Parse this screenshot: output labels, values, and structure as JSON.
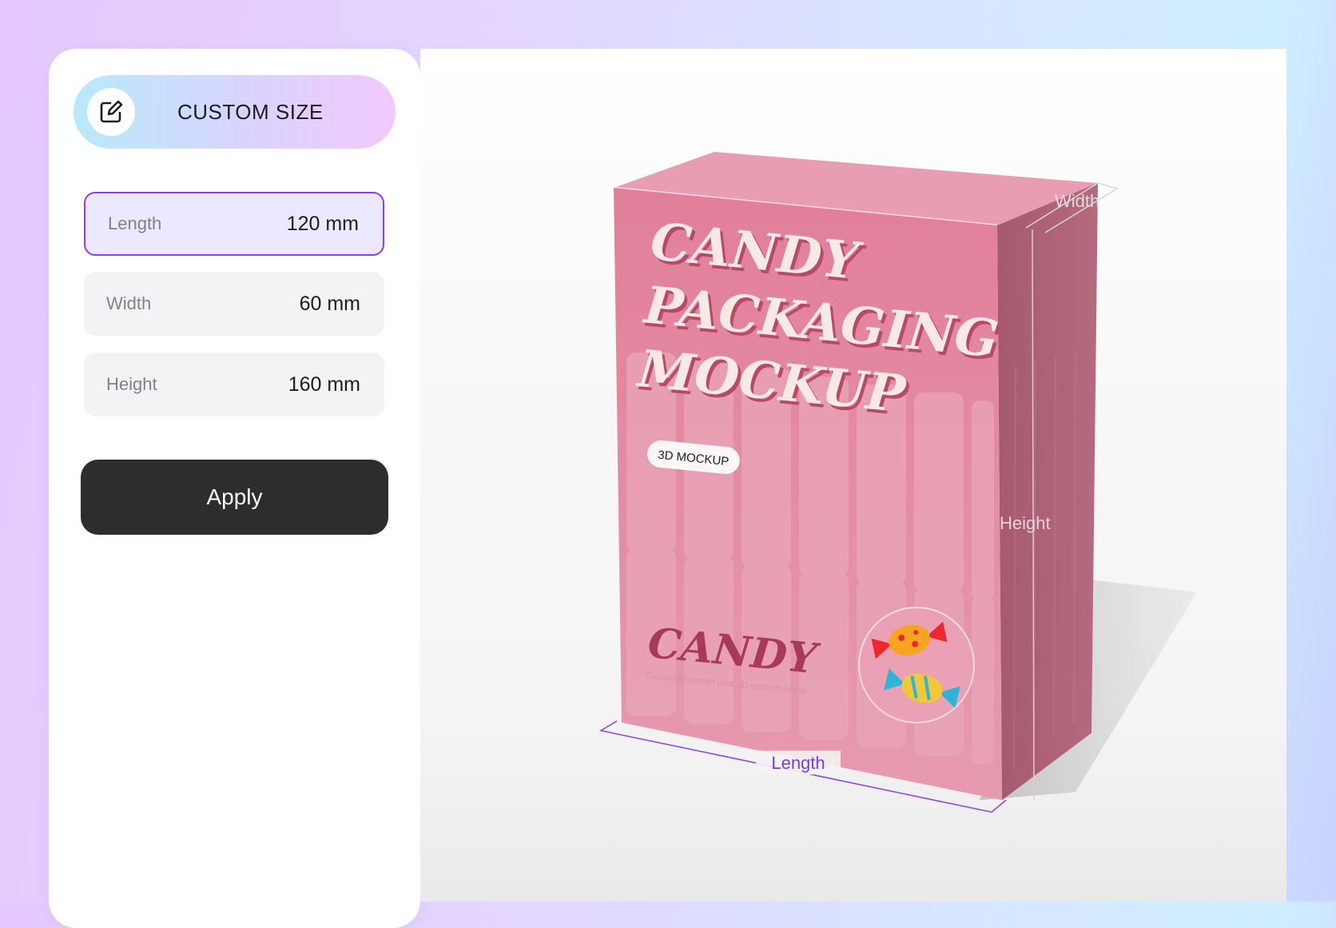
{
  "panel": {
    "header": {
      "title": "CUSTOM SIZE",
      "icon": "edit-icon"
    },
    "fields": [
      {
        "key": "length",
        "label": "Length",
        "value": "120 mm",
        "active": true
      },
      {
        "key": "width",
        "label": "Width",
        "value": "60 mm",
        "active": false
      },
      {
        "key": "height",
        "label": "Height",
        "value": "160 mm",
        "active": false
      }
    ],
    "apply_label": "Apply"
  },
  "preview": {
    "box_text": {
      "line1": "CANDY",
      "line2": "PACKAGING",
      "line3": "MOCKUP",
      "badge": "3D MOCKUP",
      "brand": "CANDY",
      "tagline": "Customise design your 3D mockup online"
    },
    "dimension_labels": {
      "width": "Width",
      "height": "Height",
      "length": "Length"
    }
  },
  "colors": {
    "accent": "#8a3ff0",
    "box_front": "#e58aa3",
    "box_side": "#a95f76",
    "button_bg": "#2d2d2d"
  }
}
